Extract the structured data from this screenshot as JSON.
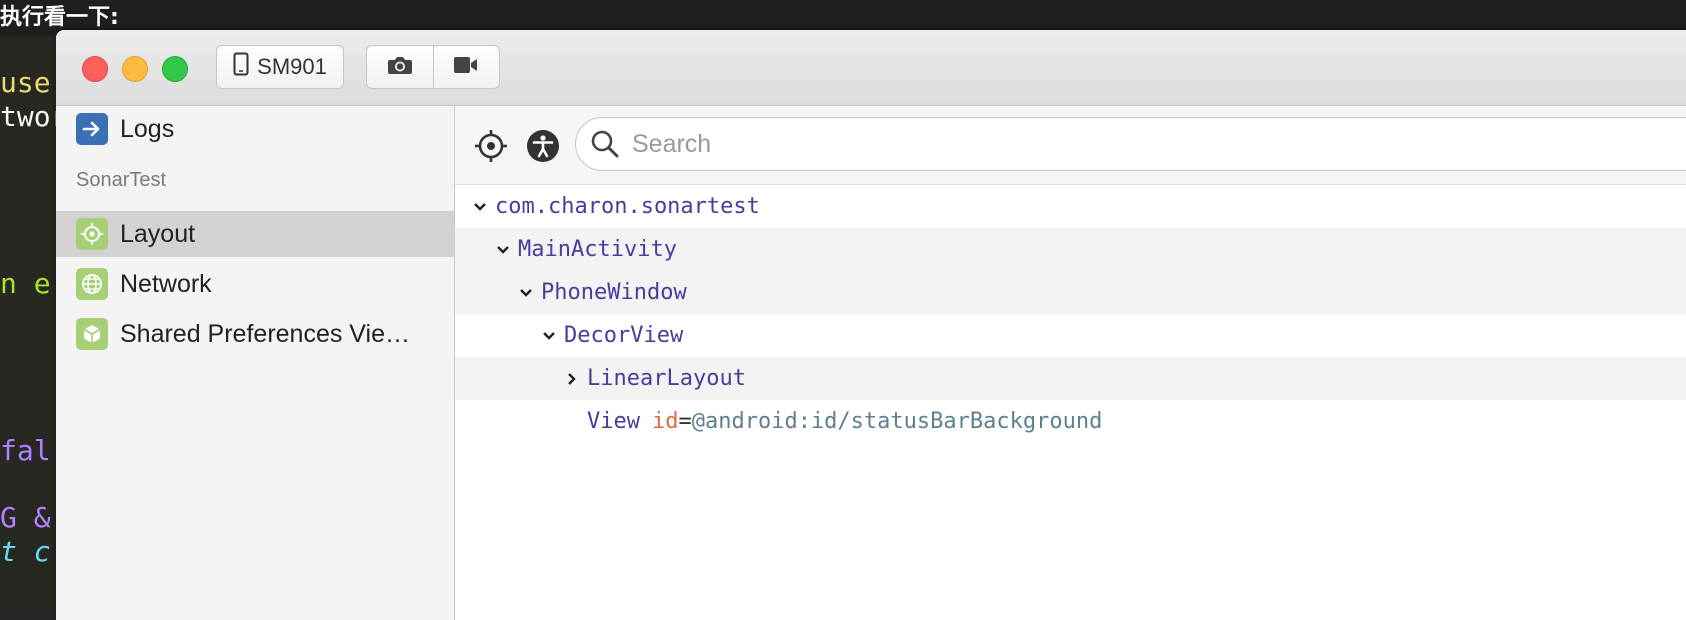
{
  "background": {
    "heading": "执行看一下:",
    "code_fragments": [
      {
        "text": "use",
        "color": "#e6db74"
      },
      {
        "text": "twor",
        "color": "#f8f8f2"
      },
      {
        "text": "n e",
        "color": "#a6e22e"
      },
      {
        "text": "fal",
        "color": "#ae81ff"
      },
      {
        "text": "G &",
        "color": "#ae81ff"
      },
      {
        "text": "t c",
        "color": "#66d9ef"
      }
    ]
  },
  "titlebar": {
    "device_label": "SM901",
    "screenshot_icon": "camera-icon",
    "record_icon": "video-icon"
  },
  "sidebar": {
    "logs_label": "Logs",
    "section_title": "SonarTest",
    "items": [
      {
        "label": "Layout",
        "icon": "layout-target-icon",
        "selected": true
      },
      {
        "label": "Network",
        "icon": "globe-icon",
        "selected": false
      },
      {
        "label": "Shared Preferences Vie…",
        "icon": "cube-icon",
        "selected": false
      }
    ]
  },
  "main": {
    "search_placeholder": "Search",
    "tree": [
      {
        "label": "com.charon.sonartest",
        "expanded": true
      },
      {
        "label": "MainActivity",
        "expanded": true
      },
      {
        "label": "PhoneWindow",
        "expanded": true
      },
      {
        "label": "DecorView",
        "expanded": true
      },
      {
        "label": "LinearLayout",
        "expanded": false
      },
      {
        "label": "View",
        "attr_name": "id",
        "attr_eq": "=",
        "attr_value": "@android:id/statusBarBackground"
      }
    ]
  },
  "colors": {
    "accent_blue": "#3b6fb6",
    "plugin_green": "#a6cf76",
    "tree_text": "#4c3b9c",
    "attr_name": "#e06c3f",
    "attr_value": "#5f7f90"
  }
}
